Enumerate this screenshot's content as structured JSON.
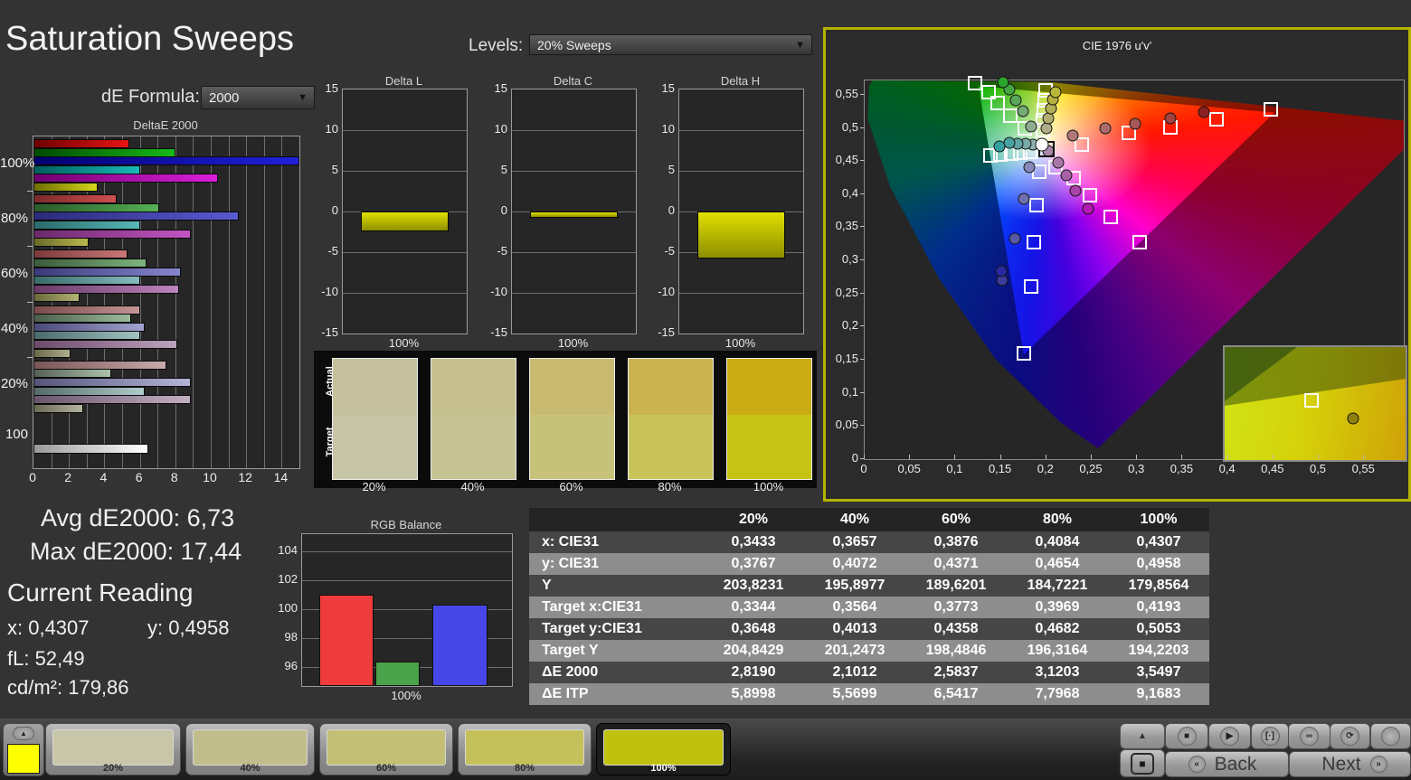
{
  "page": {
    "title": "Saturation Sweeps"
  },
  "controls": {
    "de_formula_label": "dE Formula:",
    "de_formula_value": "2000",
    "levels_label": "Levels:",
    "levels_value": "20% Sweeps"
  },
  "stats": {
    "avg": "Avg dE2000: 6,73",
    "max": "Max dE2000: 17,44",
    "current_reading": "Current Reading",
    "x": "x: 0,4307",
    "y": "y: 0,4958",
    "fl": "fL: 52,49",
    "cdm2": "cd/m²: 179,86"
  },
  "chart_data": [
    {
      "type": "bar",
      "title": "DeltaE 2000",
      "xlim": [
        0,
        15
      ],
      "xticks": [
        "0",
        "2",
        "4",
        "6",
        "8",
        "10",
        "12",
        "14"
      ],
      "groups": [
        {
          "label": "100%",
          "bars": [
            {
              "name": "red",
              "value": 5.4,
              "from": "#6e0000",
              "to": "#e81414"
            },
            {
              "name": "green",
              "value": 8.0,
              "from": "#004a00",
              "to": "#17b917"
            },
            {
              "name": "blue",
              "value": 17.44,
              "from": "#00006e",
              "to": "#2121dc"
            },
            {
              "name": "cyan",
              "value": 6.0,
              "from": "#005e5e",
              "to": "#19b9b9"
            },
            {
              "name": "magenta",
              "value": 10.4,
              "from": "#6e006e",
              "to": "#dc1edc"
            },
            {
              "name": "yellow",
              "value": 3.6,
              "from": "#6e6e00",
              "to": "#d6d61e"
            }
          ]
        },
        {
          "label": "80%",
          "bars": [
            {
              "name": "red",
              "value": 4.7,
              "from": "#7a2a2a",
              "to": "#cf4f4f"
            },
            {
              "name": "green",
              "value": 7.1,
              "from": "#2a5a2a",
              "to": "#55b055"
            },
            {
              "name": "blue",
              "value": 11.6,
              "from": "#2a2a7a",
              "to": "#5a5ad2"
            },
            {
              "name": "cyan",
              "value": 6.0,
              "from": "#2a6a6a",
              "to": "#58b8b8"
            },
            {
              "name": "magenta",
              "value": 8.9,
              "from": "#6a2a6a",
              "to": "#c455c4"
            },
            {
              "name": "yellow",
              "value": 3.1,
              "from": "#6a6a2a",
              "to": "#b9b94f"
            }
          ]
        },
        {
          "label": "60%",
          "bars": [
            {
              "name": "red",
              "value": 5.3,
              "from": "#7a3a3a",
              "to": "#c97878"
            },
            {
              "name": "green",
              "value": 6.4,
              "from": "#3a5a3a",
              "to": "#7fb57f"
            },
            {
              "name": "blue",
              "value": 8.3,
              "from": "#3a3a7a",
              "to": "#8787cf"
            },
            {
              "name": "cyan",
              "value": 6.0,
              "from": "#3a6a6a",
              "to": "#85bcbc"
            },
            {
              "name": "magenta",
              "value": 8.2,
              "from": "#6a3a6a",
              "to": "#bd85bd"
            },
            {
              "name": "yellow",
              "value": 2.6,
              "from": "#6a6a3a",
              "to": "#b2b273"
            }
          ]
        },
        {
          "label": "40%",
          "bars": [
            {
              "name": "red",
              "value": 6.0,
              "from": "#7a4a4a",
              "to": "#c59595"
            },
            {
              "name": "green",
              "value": 5.5,
              "from": "#4a5e4a",
              "to": "#9cbc9c"
            },
            {
              "name": "blue",
              "value": 6.3,
              "from": "#4a4a7a",
              "to": "#a3a3d2"
            },
            {
              "name": "cyan",
              "value": 6.0,
              "from": "#4a6a6a",
              "to": "#a3c3c3"
            },
            {
              "name": "magenta",
              "value": 8.1,
              "from": "#6a4a6a",
              "to": "#bda3bd"
            },
            {
              "name": "yellow",
              "value": 2.1,
              "from": "#6a6a4a",
              "to": "#aeae8e"
            }
          ]
        },
        {
          "label": "20%",
          "bars": [
            {
              "name": "red",
              "value": 7.5,
              "from": "#7a5555",
              "to": "#c9aaaa"
            },
            {
              "name": "green",
              "value": 4.4,
              "from": "#556055",
              "to": "#abc3ab"
            },
            {
              "name": "blue",
              "value": 8.9,
              "from": "#55557a",
              "to": "#b5b5d8"
            },
            {
              "name": "cyan",
              "value": 6.3,
              "from": "#556a6a",
              "to": "#b0cccc"
            },
            {
              "name": "magenta",
              "value": 8.9,
              "from": "#6a556a",
              "to": "#c3b0c3"
            },
            {
              "name": "yellow",
              "value": 2.8,
              "from": "#6a6a55",
              "to": "#b3b3a0"
            }
          ]
        },
        {
          "label": "100",
          "bars": [
            {
              "name": "white",
              "value": 6.5,
              "from": "#9a9a9a",
              "to": "#ffffff"
            }
          ]
        }
      ]
    },
    {
      "type": "bar",
      "title": "Delta L",
      "value": -2.2,
      "ylim": [
        -15,
        15
      ],
      "yticks": [
        "15",
        "10",
        "5",
        "0",
        "-5",
        "-10",
        "-15"
      ],
      "xlabel": "100%",
      "bar_colors": [
        "#e0e000",
        "#8e8e00"
      ]
    },
    {
      "type": "bar",
      "title": "Delta C",
      "value": -0.5,
      "ylim": [
        -15,
        15
      ],
      "yticks": [
        "15",
        "10",
        "5",
        "0",
        "-5",
        "-10",
        "-15"
      ],
      "xlabel": "100%",
      "bar_colors": [
        "#e0e000",
        "#8e8e00"
      ]
    },
    {
      "type": "bar",
      "title": "Delta H",
      "value": -5.6,
      "ylim": [
        -15,
        15
      ],
      "yticks": [
        "15",
        "10",
        "5",
        "0",
        "-5",
        "-10",
        "-15"
      ],
      "xlabel": "100%",
      "bar_colors": [
        "#e0e000",
        "#8e8e00"
      ]
    },
    {
      "type": "bar",
      "title": "RGB Balance",
      "xlabel": "100%",
      "ylim": [
        94.7,
        105.2
      ],
      "yticks": [
        "104",
        "102",
        "100",
        "98",
        "96"
      ],
      "bars": [
        {
          "name": "red",
          "value": 101.0,
          "color": "#ef3b3b"
        },
        {
          "name": "green",
          "value": 96.4,
          "color": "#4aa34a"
        },
        {
          "name": "blue",
          "value": 100.3,
          "color": "#4747e8"
        }
      ]
    },
    {
      "type": "scatter",
      "title": "CIE 1976 u'v'",
      "xticks": [
        "0",
        "0,05",
        "0,1",
        "0,15",
        "0,2",
        "0,25",
        "0,3",
        "0,35",
        "0,4",
        "0,45",
        "0,5",
        "0,55"
      ],
      "yticks": [
        "0,55",
        "0,5",
        "0,45",
        "0,4",
        "0,35",
        "0,3",
        "0,25",
        "0,2",
        "0,15",
        "0,1",
        "0,05",
        "0"
      ],
      "xlim": [
        0,
        0.5936
      ],
      "ylim": [
        0,
        0.5717
      ],
      "white_point": {
        "target": [
          0.2,
          0.468
        ],
        "measured": [
          0.195,
          0.475
        ]
      },
      "series": [
        {
          "name": "red",
          "targets": [
            [
              0.239,
              0.475
            ],
            [
              0.291,
              0.493
            ],
            [
              0.337,
              0.501
            ],
            [
              0.387,
              0.513
            ],
            [
              0.447,
              0.528
            ]
          ],
          "measured": [
            [
              0.229,
              0.489
            ],
            [
              0.265,
              0.5
            ],
            [
              0.298,
              0.506
            ],
            [
              0.337,
              0.515
            ],
            [
              0.373,
              0.524
            ]
          ],
          "colors": [
            "#b07878",
            "#ad6a6a",
            "#a85858",
            "#a34040",
            "#8c2020"
          ]
        },
        {
          "name": "green",
          "targets": [
            [
              0.176,
              0.5
            ],
            [
              0.16,
              0.519
            ],
            [
              0.146,
              0.538
            ],
            [
              0.136,
              0.554
            ],
            [
              0.122,
              0.568
            ]
          ],
          "measured": [
            [
              0.183,
              0.502
            ],
            [
              0.174,
              0.525
            ],
            [
              0.166,
              0.542
            ],
            [
              0.159,
              0.558
            ],
            [
              0.152,
              0.5695
            ]
          ],
          "colors": [
            "#8fae8f",
            "#74aa74",
            "#58a658",
            "#42a542",
            "#2aa42a"
          ]
        },
        {
          "name": "blue",
          "targets": [
            [
              0.192,
              0.434
            ],
            [
              0.189,
              0.384
            ],
            [
              0.186,
              0.327
            ],
            [
              0.183,
              0.261
            ],
            [
              0.175,
              0.159
            ]
          ],
          "measured": [
            [
              0.181,
              0.441
            ],
            [
              0.175,
              0.393
            ],
            [
              0.165,
              0.333
            ],
            [
              0.151,
              0.27
            ],
            [
              0.15,
              0.284
            ]
          ],
          "colors": [
            "#8888b8",
            "#7070b0",
            "#5858a8",
            "#3c3c9c",
            "#2828a0"
          ]
        },
        {
          "name": "cyan",
          "targets": [
            [
              0.182,
              0.464
            ],
            [
              0.171,
              0.4625
            ],
            [
              0.161,
              0.461
            ],
            [
              0.149,
              0.46
            ],
            [
              0.138,
              0.458
            ]
          ],
          "measured": [
            [
              0.185,
              0.4755
            ],
            [
              0.177,
              0.476
            ],
            [
              0.168,
              0.4765
            ],
            [
              0.159,
              0.477
            ],
            [
              0.1485,
              0.4715
            ]
          ],
          "colors": [
            "#8fb0ae",
            "#78aaa8",
            "#60a6a4",
            "#48a2a0",
            "#35a0a0"
          ]
        },
        {
          "name": "magenta",
          "targets": [
            [
              0.21,
              0.441
            ],
            [
              0.23,
              0.424
            ],
            [
              0.248,
              0.399
            ],
            [
              0.271,
              0.366
            ],
            [
              0.303,
              0.327
            ]
          ],
          "measured": [
            [
              0.202,
              0.465
            ],
            [
              0.213,
              0.448
            ],
            [
              0.222,
              0.428
            ],
            [
              0.232,
              0.405
            ],
            [
              0.246,
              0.378
            ]
          ],
          "colors": [
            "#a888a8",
            "#a878a8",
            "#a860a8",
            "#a844a8",
            "#b518b5"
          ]
        },
        {
          "name": "yellow",
          "targets": [
            [
              0.196,
              0.497
            ],
            [
              0.1965,
              0.512
            ],
            [
              0.197,
              0.527
            ],
            [
              0.198,
              0.542
            ],
            [
              0.199,
              0.557
            ]
          ],
          "measured": [
            [
              0.2,
              0.499
            ],
            [
              0.2025,
              0.514
            ],
            [
              0.205,
              0.529
            ],
            [
              0.2075,
              0.543
            ],
            [
              0.21,
              0.5545
            ]
          ],
          "colors": [
            "#b0ac88",
            "#b2ac70",
            "#b4ae58",
            "#b6b040",
            "#b8b838"
          ]
        }
      ],
      "inset": {
        "square": [
          48,
          47
        ],
        "circle": [
          71,
          63
        ],
        "circle_color": "#8f7f0e"
      }
    }
  ],
  "swatch_panel": {
    "row_labels": [
      "Actual",
      "Target"
    ],
    "columns": [
      {
        "label": "20%",
        "actual": "#c5c19e",
        "target": "#c7c5a7"
      },
      {
        "label": "40%",
        "actual": "#c6c08e",
        "target": "#c5c293"
      },
      {
        "label": "60%",
        "actual": "#c9ba72",
        "target": "#c7c279"
      },
      {
        "label": "80%",
        "actual": "#cbb450",
        "target": "#c9c459"
      },
      {
        "label": "100%",
        "actual": "#c9ac14",
        "target": "#c5c414"
      }
    ]
  },
  "table": {
    "col_headers": [
      "",
      "20%",
      "40%",
      "60%",
      "80%",
      "100%"
    ],
    "rows": [
      {
        "label": "x: CIE31",
        "values": [
          "0,3433",
          "0,3657",
          "0,3876",
          "0,4084",
          "0,4307"
        ]
      },
      {
        "label": "y: CIE31",
        "values": [
          "0,3767",
          "0,4072",
          "0,4371",
          "0,4654",
          "0,4958"
        ]
      },
      {
        "label": "Y",
        "values": [
          "203,8231",
          "195,8977",
          "189,6201",
          "184,7221",
          "179,8564"
        ]
      },
      {
        "label": "Target x:CIE31",
        "values": [
          "0,3344",
          "0,3564",
          "0,3773",
          "0,3969",
          "0,4193"
        ]
      },
      {
        "label": "Target y:CIE31",
        "values": [
          "0,3648",
          "0,4013",
          "0,4358",
          "0,4682",
          "0,5053"
        ]
      },
      {
        "label": "Target Y",
        "values": [
          "204,8429",
          "201,2473",
          "198,4846",
          "196,3164",
          "194,2203"
        ]
      },
      {
        "label": "ΔE 2000",
        "values": [
          "2,8190",
          "2,1012",
          "2,5837",
          "3,1203",
          "3,5497"
        ]
      },
      {
        "label": "ΔE ITP",
        "values": [
          "5,8998",
          "5,5699",
          "6,5417",
          "7,7968",
          "9,1683"
        ]
      }
    ]
  },
  "bottom_bar": {
    "current_patch_color": "#ffff00",
    "patch_up_arrow": "▲",
    "tiles": [
      {
        "label": "20%",
        "color": "#c8c6a8",
        "selected": false
      },
      {
        "label": "40%",
        "color": "#c2be8c",
        "selected": false
      },
      {
        "label": "60%",
        "color": "#c3bf75",
        "selected": false
      },
      {
        "label": "80%",
        "color": "#c5c15a",
        "selected": false
      },
      {
        "label": "100%",
        "color": "#c0c00e",
        "selected": true
      }
    ],
    "transport": [
      {
        "name": "stop",
        "glyph": "■"
      },
      {
        "name": "play",
        "glyph": "▶"
      },
      {
        "name": "single-measure",
        "glyph": "[·]"
      },
      {
        "name": "continuous",
        "glyph": "∞"
      },
      {
        "name": "loop",
        "glyph": "⟳"
      },
      {
        "name": "record",
        "glyph": ""
      }
    ],
    "stop_big_glyph": "■",
    "up_arrow": "▲",
    "back_label": "Back",
    "next_label": "Next",
    "back_icon": "«",
    "next_icon": "»"
  }
}
